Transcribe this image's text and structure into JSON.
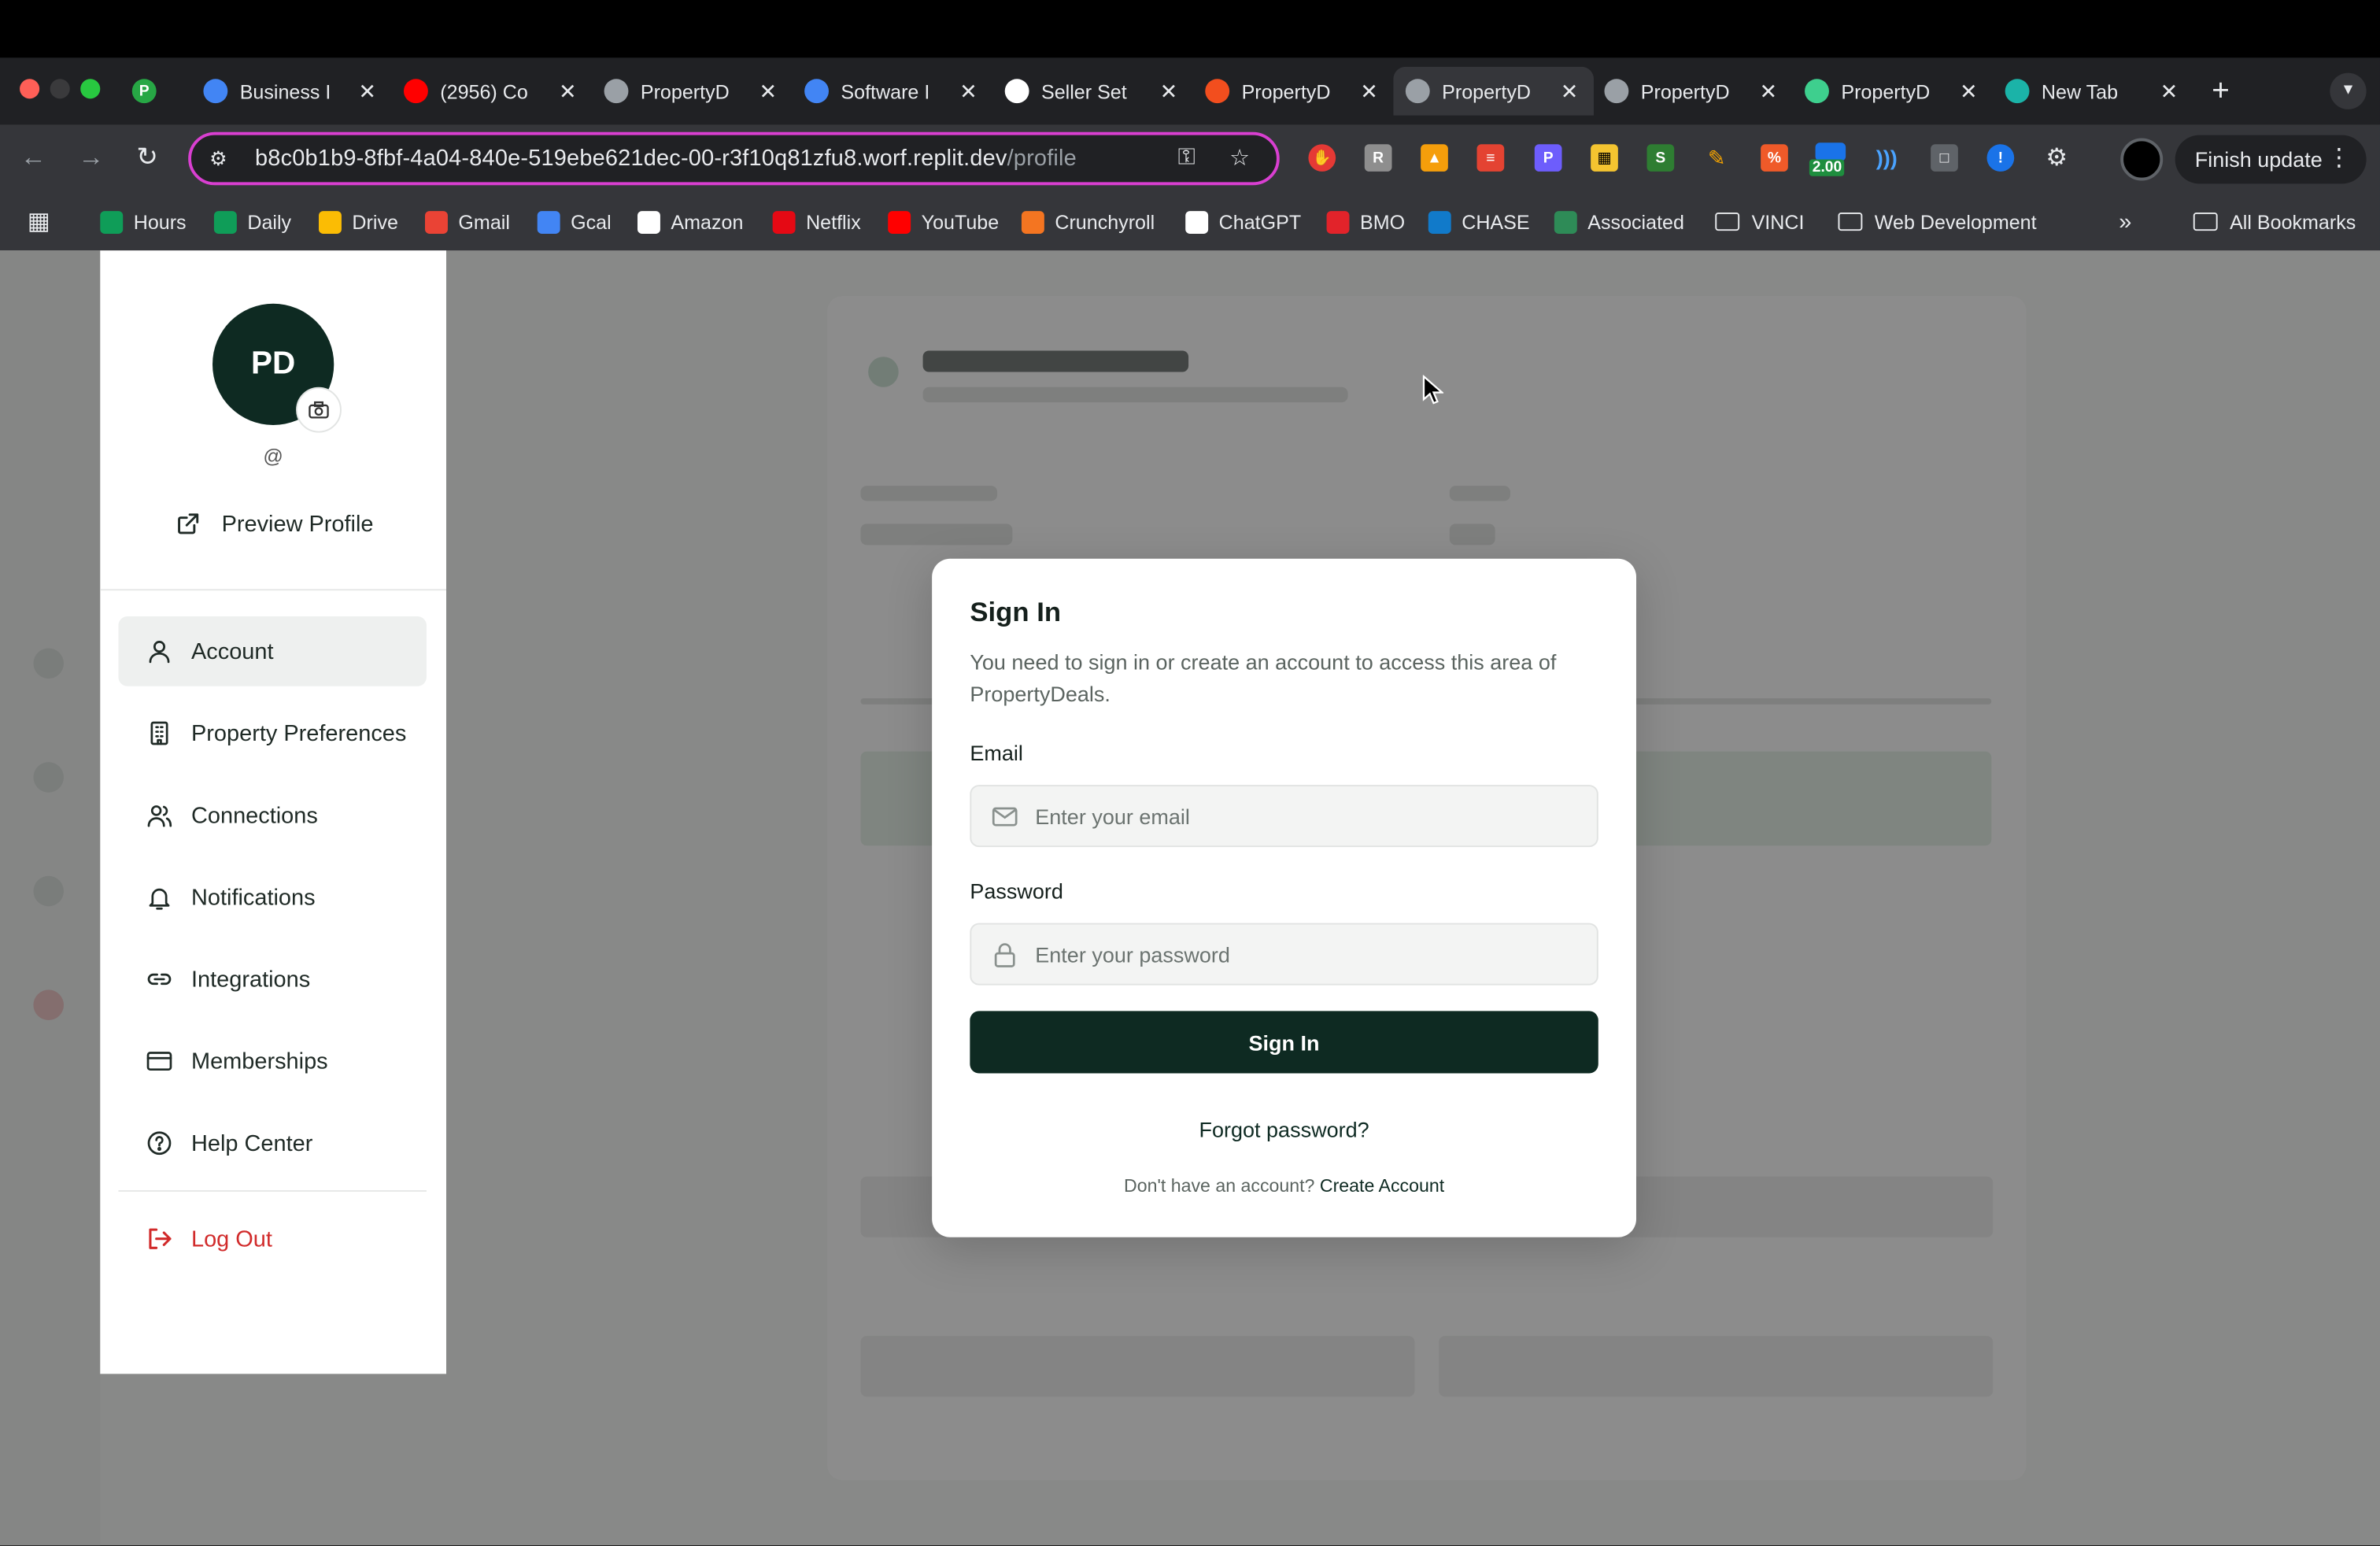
{
  "browser": {
    "tabs": [
      {
        "label": "P",
        "icon": "profile-icon",
        "color": "#27a745"
      },
      {
        "label": "Business I",
        "icon": "docs-icon",
        "color": "#4285f4"
      },
      {
        "label": "(2956) Co",
        "icon": "youtube-icon",
        "color": "#ff0000"
      },
      {
        "label": "PropertyD",
        "icon": "globe-icon",
        "color": "#9aa0a6"
      },
      {
        "label": "Software I",
        "icon": "docs-icon",
        "color": "#4285f4"
      },
      {
        "label": "Seller Set",
        "icon": "chatgpt-icon",
        "color": "#ffffff"
      },
      {
        "label": "PropertyD",
        "icon": "figma-icon",
        "color": "#f24e1e"
      },
      {
        "label": "PropertyD",
        "icon": "globe-icon",
        "color": "#9aa0a6"
      },
      {
        "label": "PropertyD",
        "icon": "globe-icon",
        "color": "#9aa0a6"
      },
      {
        "label": "PropertyD",
        "icon": "bolt-icon",
        "color": "#3ecf8e"
      },
      {
        "label": "New Tab",
        "icon": "m-icon",
        "color": "#1bb3a8"
      }
    ],
    "url_host": "b8c0b1b9-8fbf-4a04-840e-519ebe621dec-00-r3f10q81zfu8.worf.replit.dev",
    "url_path": "/profile",
    "finish_update": "Finish update",
    "ext_badge": "2.00",
    "bookmarks": [
      {
        "label": "Hours",
        "icon": "sheets-icon",
        "color": "#0f9d58"
      },
      {
        "label": "Daily",
        "icon": "sheets-icon",
        "color": "#0f9d58"
      },
      {
        "label": "Drive",
        "icon": "drive-icon",
        "color": "#fbbc04"
      },
      {
        "label": "Gmail",
        "icon": "gmail-icon",
        "color": "#ea4335"
      },
      {
        "label": "Gcal",
        "icon": "calendar-icon",
        "color": "#4285f4"
      },
      {
        "label": "Amazon",
        "icon": "amazon-icon",
        "color": "#ffffff"
      },
      {
        "label": "Netflix",
        "icon": "netflix-icon",
        "color": "#e50914"
      },
      {
        "label": "YouTube",
        "icon": "youtube-icon",
        "color": "#ff0000"
      },
      {
        "label": "Crunchyroll",
        "icon": "crunchyroll-icon",
        "color": "#f47521"
      },
      {
        "label": "ChatGPT",
        "icon": "chatgpt-icon",
        "color": "#ffffff"
      },
      {
        "label": "BMO",
        "icon": "bmo-icon",
        "color": "#e2232a"
      },
      {
        "label": "CHASE",
        "icon": "chase-icon",
        "color": "#117aca"
      },
      {
        "label": "Associated",
        "icon": "associated-icon",
        "color": "#2e8b57"
      },
      {
        "label": "VINCI",
        "icon": "folder-icon",
        "color": "#e8eaed"
      },
      {
        "label": "Web Development",
        "icon": "folder-icon",
        "color": "#e8eaed"
      }
    ],
    "all_bookmarks": "All Bookmarks"
  },
  "sidebar": {
    "initials": "PD",
    "handle": "@",
    "preview_label": "Preview Profile",
    "items": [
      {
        "label": "Account",
        "icon": "user-icon",
        "active": true
      },
      {
        "label": "Property Preferences",
        "icon": "building-icon"
      },
      {
        "label": "Connections",
        "icon": "users-icon"
      },
      {
        "label": "Notifications",
        "icon": "bell-icon"
      },
      {
        "label": "Integrations",
        "icon": "link-icon"
      },
      {
        "label": "Memberships",
        "icon": "card-icon"
      },
      {
        "label": "Help Center",
        "icon": "help-icon"
      }
    ],
    "logout_label": "Log Out"
  },
  "modal": {
    "title": "Sign In",
    "description": "You need to sign in or create an account to access this area of PropertyDeals.",
    "email_label": "Email",
    "email_placeholder": "Enter your email",
    "password_label": "Password",
    "password_placeholder": "Enter your password",
    "submit_label": "Sign In",
    "forgot_label": "Forgot password?",
    "footer_prefix": "Don't have an account?",
    "footer_link": "Create Account"
  },
  "colors": {
    "brand": "#0e2a22",
    "danger": "#d12b2b",
    "omnibox_border": "#d93fd1"
  }
}
